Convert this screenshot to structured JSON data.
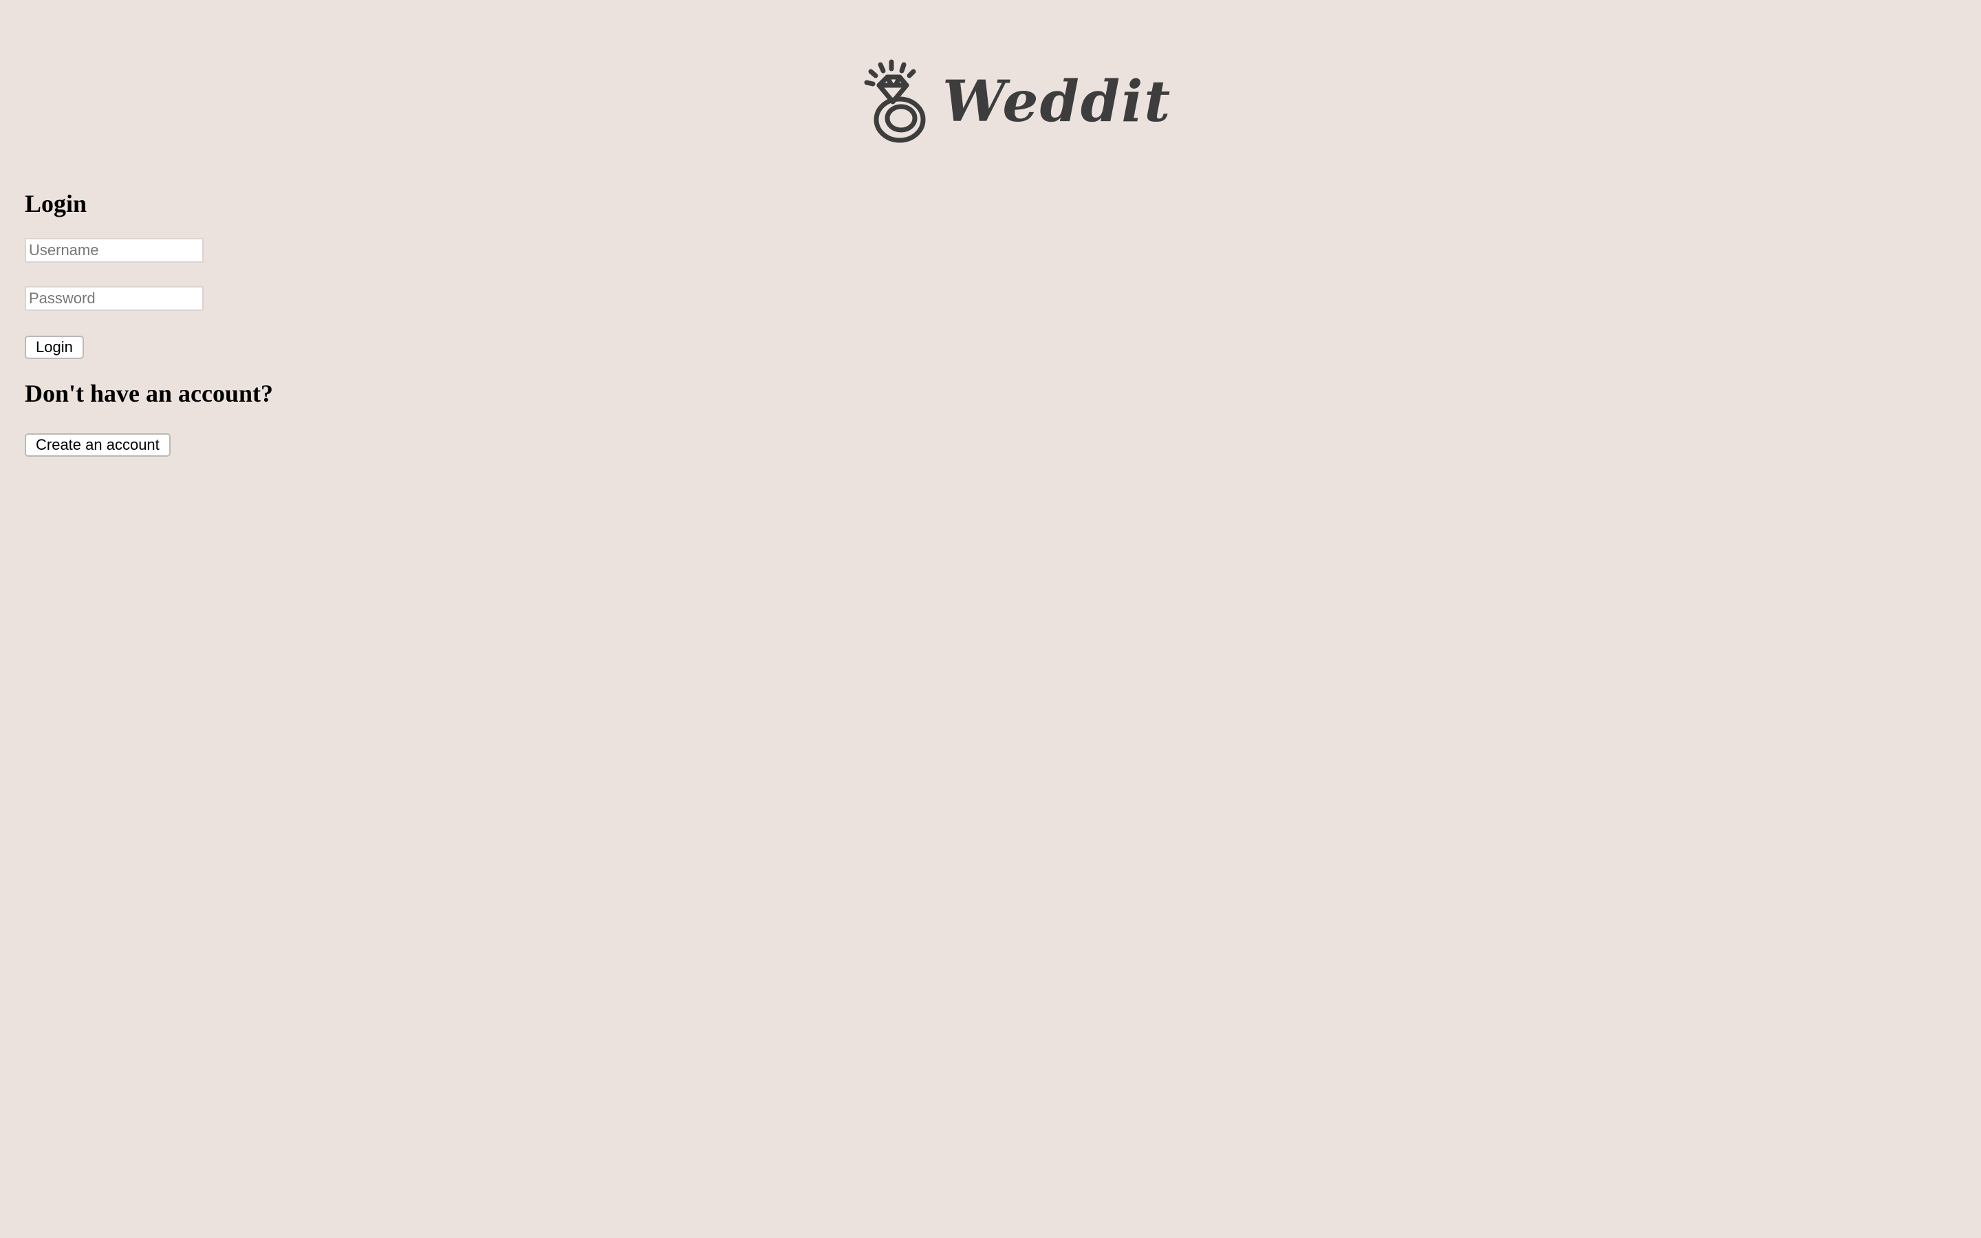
{
  "header": {
    "brand_name": "Weddit",
    "logo_icon": "diamond-ring-icon",
    "logo_color": "#3e3d3d"
  },
  "login": {
    "heading": "Login",
    "username_placeholder": "Username",
    "username_value": "",
    "password_placeholder": "Password",
    "password_value": "",
    "submit_label": "Login"
  },
  "signup": {
    "heading": "Don't have an account?",
    "create_account_label": "Create an account"
  },
  "colors": {
    "page_background": "#ebe2de",
    "brand_text": "#3e3d3d"
  }
}
